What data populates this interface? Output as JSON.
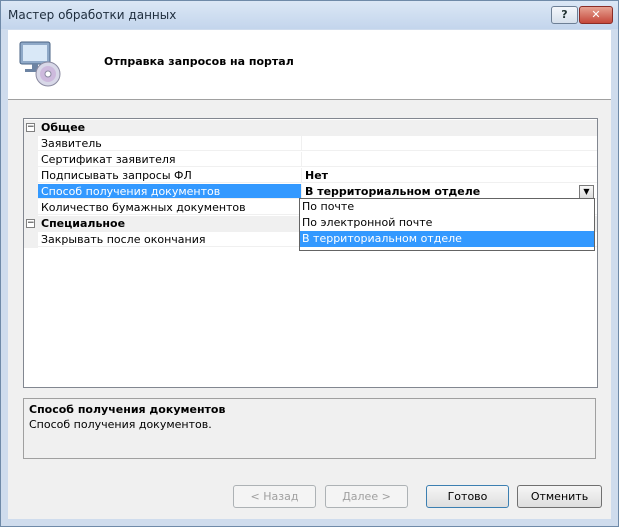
{
  "window": {
    "title": "Мастер обработки данных",
    "help_label": "?",
    "close_label": "✕"
  },
  "header": {
    "title": "Отправка запросов на портал",
    "icon": "computer-disc-icon"
  },
  "grid": {
    "categories": [
      {
        "label": "Общее",
        "toggle": "⊟",
        "rows": [
          {
            "name": "Заявитель",
            "value": ""
          },
          {
            "name": "Сертификат заявителя",
            "value": ""
          },
          {
            "name": "Подписывать запросы ФЛ",
            "value": "Нет"
          },
          {
            "name": "Способ получения документов",
            "value": "В территориальном отделе"
          },
          {
            "name": "Количество бумажных документов",
            "value": ""
          }
        ]
      },
      {
        "label": "Специальное",
        "toggle": "⊟",
        "rows": [
          {
            "name": "Закрывать после окончания",
            "value": ""
          }
        ]
      }
    ]
  },
  "dropdown": {
    "arrow": "▼",
    "options": [
      "По почте",
      "По электронной почте",
      "В территориальном отделе"
    ],
    "selected_index": 2
  },
  "description": {
    "title": "Способ получения документов",
    "text": "Способ получения документов."
  },
  "buttons": {
    "back": "< Назад",
    "next": "Далее >",
    "finish": "Готово",
    "cancel": "Отменить"
  },
  "colors": {
    "selection": "#3399ff",
    "frame": "#cfdced"
  }
}
